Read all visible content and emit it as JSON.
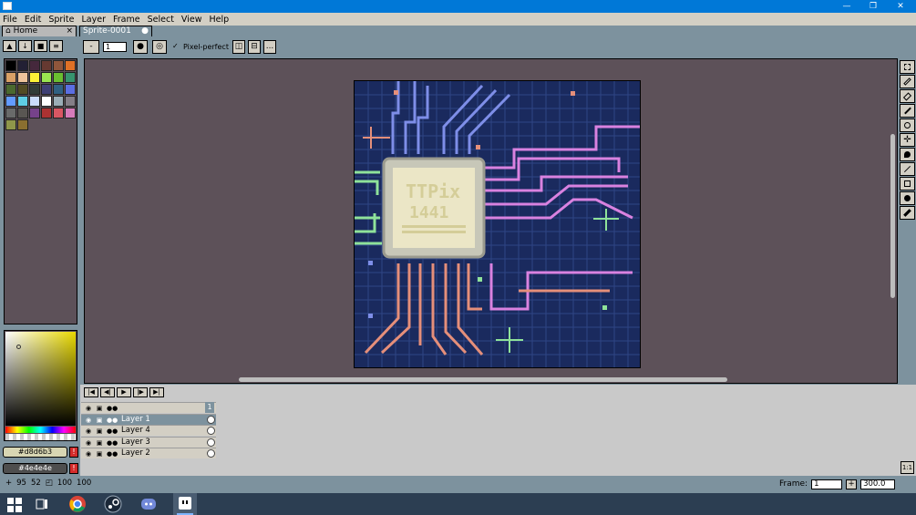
{
  "menu": [
    "File",
    "Edit",
    "Sprite",
    "Layer",
    "Frame",
    "Select",
    "View",
    "Help"
  ],
  "tabs": {
    "home": "Home",
    "sprite": "Sprite-0001"
  },
  "context": {
    "zoom_value": "1",
    "pixel_perfect_label": "Pixel-perfect",
    "more_label": "..."
  },
  "palette": {
    "colors": [
      "#000000",
      "#222034",
      "#45283c",
      "#663931",
      "#8f563b",
      "#df7126",
      "#d9a066",
      "#eec39a",
      "#fbf236",
      "#99e550",
      "#6abe30",
      "#37946e",
      "#4b692f",
      "#524b24",
      "#323c39",
      "#3f3f74",
      "#306082",
      "#5b6ee1",
      "#639bff",
      "#5fcde4",
      "#cbdbfc",
      "#ffffff",
      "#9badb7",
      "#847e87",
      "#696a6a",
      "#595652",
      "#76428a",
      "#ac3232",
      "#d95763",
      "#d77bba",
      "#8f974a",
      "#8a6f30"
    ]
  },
  "colors": {
    "foreground": "#d8d6b3",
    "background": "#4e4e4e"
  },
  "status": {
    "x": "95",
    "y": "52",
    "w": "100",
    "h": "100"
  },
  "layers": [
    {
      "name": "",
      "type": "group"
    },
    {
      "name": "Layer 1",
      "selected": true
    },
    {
      "name": "Layer 4",
      "selected": false
    },
    {
      "name": "Layer 3",
      "selected": false
    },
    {
      "name": "Layer 2",
      "selected": false
    }
  ],
  "timeline": {
    "frame_number": "1"
  },
  "frame_info": {
    "label": "Frame:",
    "frame_value": "1",
    "add": "+",
    "duration": "300.0"
  },
  "ratio_label": "1:1",
  "artwork": {
    "chip_line1": "TTPix",
    "chip_line2": "1441"
  },
  "taskbar": {
    "apps": [
      "start-icon",
      "task-view-icon",
      "chrome-icon",
      "steam-icon",
      "discord-icon",
      "aseprite-icon"
    ]
  }
}
